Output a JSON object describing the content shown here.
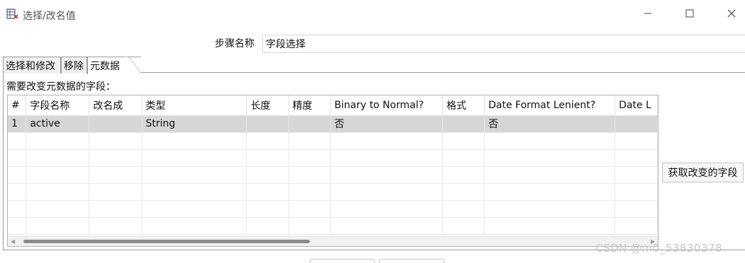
{
  "window": {
    "title": "选择/改名值",
    "icon": "app-table-icon",
    "controls": [
      "minimize-icon",
      "maximize-icon",
      "close-icon"
    ]
  },
  "step": {
    "label": "步骤名称",
    "value": "字段选择"
  },
  "tabs": [
    {
      "label": "选择和修改",
      "active": false
    },
    {
      "label": "移除",
      "active": false
    },
    {
      "label": "元数据",
      "active": true
    }
  ],
  "fields_section": {
    "label": "需要改变元数据的字段："
  },
  "table": {
    "columns": [
      "#",
      "字段名称",
      "改名成",
      "类型",
      "长度",
      "精度",
      "Binary to Normal?",
      "格式",
      "Date Format Lenient?",
      "Date L"
    ],
    "rows": [
      [
        "1",
        "active",
        "",
        "String",
        "",
        "",
        "否",
        "",
        "否",
        ""
      ]
    ],
    "empty_rows": 6,
    "scrollbar_position": 0.0
  },
  "buttons": {
    "get_changed_fields": "获取改变的字段"
  },
  "watermark": "CSDN @m0_53830378",
  "colors": {
    "selected_row": "#d6d6d6",
    "border": "#9a9a9a"
  }
}
